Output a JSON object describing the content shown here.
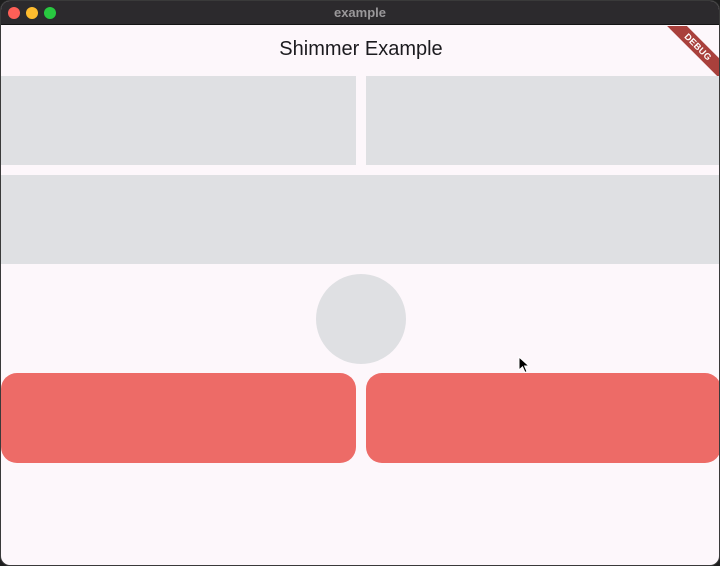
{
  "window": {
    "title": "example"
  },
  "app": {
    "title": "Shimmer Example",
    "debug_label": "DEBUG"
  },
  "colors": {
    "shimmer": "#dfe0e3",
    "card": "#ed6b67",
    "background": "#fdf7fb"
  }
}
